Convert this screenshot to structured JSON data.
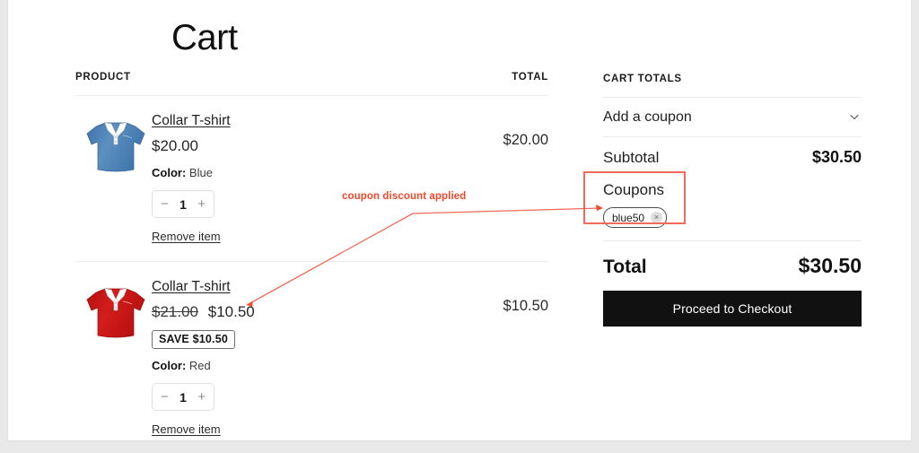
{
  "page": {
    "title": "Cart"
  },
  "table": {
    "col_product": "PRODUCT",
    "col_total": "TOTAL"
  },
  "items": [
    {
      "name": "Collar T-shirt",
      "price": "$20.00",
      "old_price": "",
      "save_badge": "",
      "variant_label": "Color:",
      "variant_value": "Blue",
      "quantity": "1",
      "decrement": "−",
      "increment": "+",
      "remove_label": "Remove item",
      "line_total": "$20.00",
      "swatch": "#4a7fb5",
      "shirt_dark": "#2f6197",
      "shirt_light": "#6a9bc9"
    },
    {
      "name": "Collar T-shirt",
      "price": "$10.50",
      "old_price": "$21.00",
      "save_badge": "SAVE $10.50",
      "variant_label": "Color:",
      "variant_value": "Red",
      "quantity": "1",
      "decrement": "−",
      "increment": "+",
      "remove_label": "Remove item",
      "line_total": "$10.50",
      "swatch": "#cc1111",
      "shirt_dark": "#a80d0d",
      "shirt_light": "#e03030"
    }
  ],
  "totals": {
    "heading": "CART TOTALS",
    "add_coupon_label": "Add a coupon",
    "subtotal_label": "Subtotal",
    "subtotal_value": "$30.50",
    "coupons_label": "Coupons",
    "coupon_code": "blue50",
    "coupon_remove": "×",
    "total_label": "Total",
    "total_value": "$30.50",
    "checkout_label": "Proceed to Checkout"
  },
  "annotation": {
    "text": "coupon discount applied",
    "color": "#f4482a",
    "box_color": "#f4695a"
  }
}
